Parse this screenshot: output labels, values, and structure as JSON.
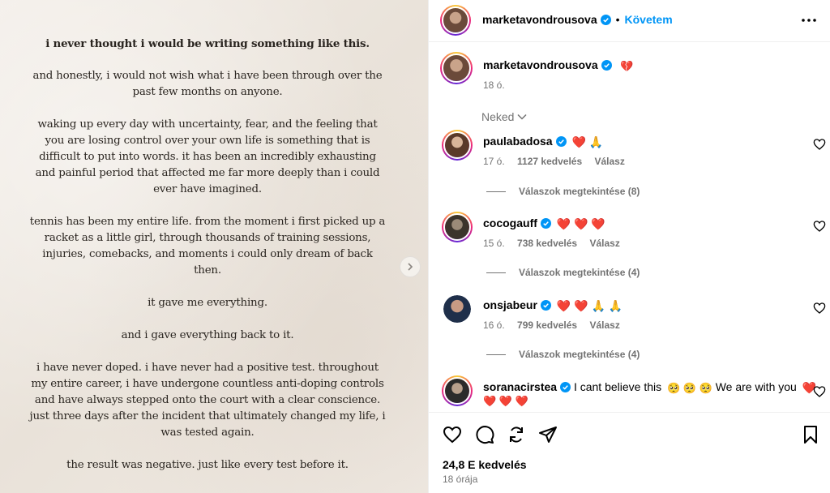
{
  "letter": {
    "paragraphs": [
      "i never thought i would be writing something like this.",
      "and honestly, i would not wish what i have been through over the past few months on anyone.",
      "waking up every day with uncertainty, fear, and the feeling that you are losing control over your own life is something that is difficult to put into words. it has been an incredibly exhausting and painful period that affected me far more deeply than i could ever have imagined.",
      "tennis has been my entire life. from the moment i first picked up a racket as a little girl, through thousands of training sessions, injuries, comebacks, and moments i could only dream of back then.",
      "it gave me everything.",
      "and i gave everything back to it.",
      "i have never doped. i have never had a positive test. throughout my entire career, i have undergone countless anti-doping controls and have always stepped onto the court with a clear conscience. just three days after the incident that ultimately changed my life, i was tested again.",
      "the result was negative. just like every test before it."
    ]
  },
  "header": {
    "username": "marketavondrousova",
    "dot": "•",
    "follow_label": "Követem",
    "more_icon": "more-horizontal-icon"
  },
  "caption": {
    "username": "marketavondrousova",
    "emoji": "💔",
    "time": "18 ó."
  },
  "sort_label": "Neked",
  "comments": [
    {
      "username": "paulabadosa",
      "text": "",
      "emojis": "❤️ 🙏",
      "time": "17 ó.",
      "likes": "1127 kedvelés",
      "reply": "Válasz",
      "replies": "Válaszok megtekintése (8)",
      "avatar_color": "#5a3a2a"
    },
    {
      "username": "cocogauff",
      "text": "",
      "emojis": "❤️ ❤️ ❤️",
      "time": "15 ó.",
      "likes": "738 kedvelés",
      "reply": "Válasz",
      "replies": "Válaszok megtekintése (4)",
      "avatar_color": "#3b342c"
    },
    {
      "username": "onsjabeur",
      "text": "",
      "emojis": "❤️ ❤️ 🙏 🙏",
      "time": "16 ó.",
      "likes": "799 kedvelés",
      "reply": "Válasz",
      "replies": "Válaszok megtekintése (4)",
      "avatar_color": "#1f2f4a"
    },
    {
      "username": "soranacirstea",
      "text": "I cant believe this",
      "emojis": "🥺 🥺 🥺",
      "text2": "We are with you",
      "emojis2": "❤️",
      "line2": "❤️ ❤️ ❤️",
      "avatar_color": "#2b2b2b"
    }
  ],
  "actions": {
    "like_icon": "heart-icon",
    "comment_icon": "comment-icon",
    "share_icon": "repost-icon",
    "send_icon": "send-icon",
    "save_icon": "bookmark-icon"
  },
  "likes_total": "24,8 E kedvelés",
  "posted": "18 órája",
  "colors": {
    "accent": "#0095f6",
    "muted": "#737373",
    "heart": "#ed1c3c"
  }
}
